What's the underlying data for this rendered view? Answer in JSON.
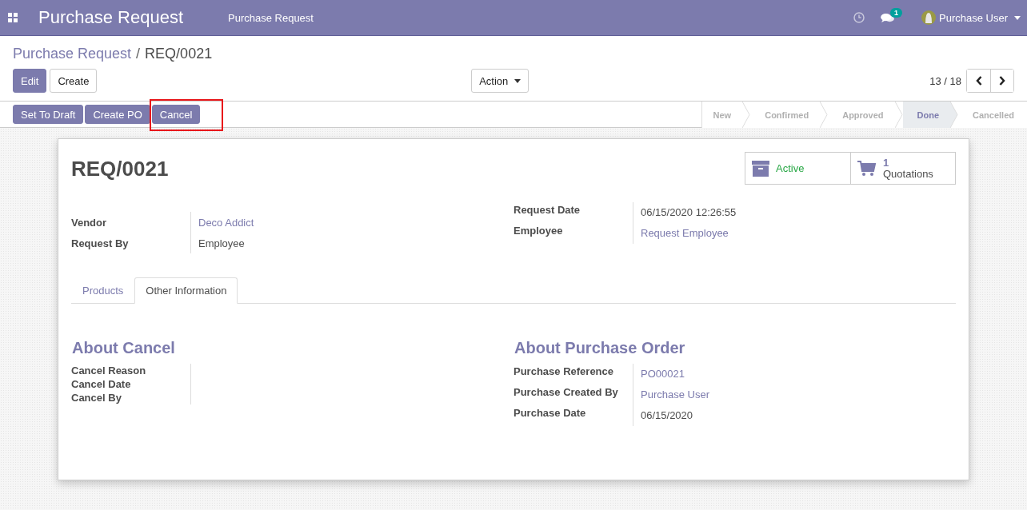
{
  "navbar": {
    "app_title": "Purchase Request",
    "menu_items": [
      "Purchase Request"
    ],
    "messages_badge": "1",
    "user": "Purchase User"
  },
  "breadcrumb_separator": "/",
  "breadcrumb": [
    {
      "label": "Purchase Request",
      "kind": "link"
    },
    {
      "label": "REQ/0021",
      "kind": "current"
    }
  ],
  "control_buttons": [
    {
      "label": "Edit",
      "kind": "primary"
    },
    {
      "label": "Create",
      "kind": "secondary"
    }
  ],
  "action_menu": "Action",
  "pager": "13 / 18",
  "header_buttons": [
    {
      "label": "Set To Draft",
      "highlighted": false
    },
    {
      "label": "Create PO",
      "highlighted": false
    },
    {
      "label": "Cancel",
      "highlighted": true
    }
  ],
  "stages": [
    {
      "label": "New",
      "selected": false
    },
    {
      "label": "Confirmed",
      "selected": false
    },
    {
      "label": "Approved",
      "selected": false
    },
    {
      "label": "Done",
      "selected": true
    },
    {
      "label": "Cancelled",
      "selected": false
    }
  ],
  "record": {
    "title": "REQ/0021",
    "active_label": "Active",
    "quotations_count": "1",
    "quotations_label": "Quotations"
  },
  "fields_left": [
    {
      "label": "Vendor",
      "value": "Deco Addict",
      "kind": "link"
    },
    {
      "label": "Request By",
      "value": "Employee",
      "kind": "text"
    }
  ],
  "fields_right": [
    {
      "label": "Request Date",
      "value": "06/15/2020 12:26:55",
      "kind": "text"
    },
    {
      "label": "Employee",
      "value": "Request Employee",
      "kind": "link"
    }
  ],
  "tabs": [
    {
      "label": "Products",
      "selected": false
    },
    {
      "label": "Other Information",
      "selected": true
    }
  ],
  "about_cancel": {
    "title": "About Cancel",
    "fields": [
      {
        "label": "Cancel Reason"
      },
      {
        "label": "Cancel Date"
      },
      {
        "label": "Cancel By"
      }
    ]
  },
  "about_purchase": {
    "title": "About Purchase Order",
    "fields": [
      {
        "label": "Purchase Reference",
        "value": "PO00021",
        "kind": "link"
      },
      {
        "label": "Purchase Created By",
        "value": "Purchase User",
        "kind": "link"
      },
      {
        "label": "Purchase Date",
        "value": "06/15/2020",
        "kind": "text"
      }
    ]
  }
}
